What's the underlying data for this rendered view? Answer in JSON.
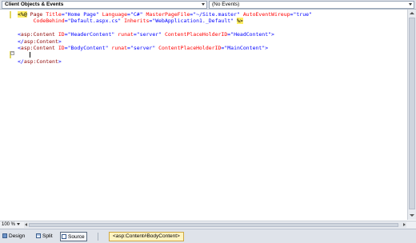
{
  "navigation_bar": {
    "objects_dropdown": "Client Objects & Events",
    "events_dropdown": "(No Events)"
  },
  "editor": {
    "lines": [
      {
        "kind": "directive",
        "open": "<%@",
        "keyword": " Page ",
        "attrs": [
          [
            "Title",
            "\"Home Page\""
          ],
          [
            "Language",
            "\"C#\""
          ],
          [
            "MasterPageFile",
            "\"~/Site.master\""
          ],
          [
            "AutoEventWireup",
            "\"true\""
          ]
        ]
      },
      {
        "kind": "directive_cont",
        "attrs": [
          [
            "CodeBehind",
            "\"Default.aspx.cs\""
          ],
          [
            "Inherits",
            "\"WebApplication1._Default\""
          ]
        ],
        "close": "%>"
      },
      {
        "kind": "blank"
      },
      {
        "kind": "tag_open",
        "tag": "asp:Content",
        "attrs": [
          [
            "ID",
            "\"HeaderContent\""
          ],
          [
            "runat",
            "\"server\""
          ],
          [
            "ContentPlaceHolderID",
            "\"HeadContent\""
          ]
        ]
      },
      {
        "kind": "tag_close",
        "tag": "asp:Content"
      },
      {
        "kind": "tag_open",
        "tag": "asp:Content",
        "attrs": [
          [
            "ID",
            "\"BodyContent\""
          ],
          [
            "runat",
            "\"server\""
          ],
          [
            "ContentPlaceHolderID",
            "\"MainContent\""
          ]
        ]
      },
      {
        "kind": "caret"
      },
      {
        "kind": "tag_close",
        "tag": "asp:Content"
      }
    ]
  },
  "status": {
    "zoom": "100 %"
  },
  "view_tabs": [
    {
      "label": "Design",
      "icon": "design-view-icon",
      "active": false
    },
    {
      "label": "Split",
      "icon": "split-view-icon",
      "active": false
    },
    {
      "label": "Source",
      "icon": "source-view-icon",
      "active": true
    }
  ],
  "tag_navigator": "<asp:Content#BodyContent>",
  "colors": {
    "directive_highlight": "#ffee62",
    "tag": "#8b0000",
    "attribute": "#ff0000",
    "value": "#0000ff",
    "change_bar": "#e3d75e"
  }
}
